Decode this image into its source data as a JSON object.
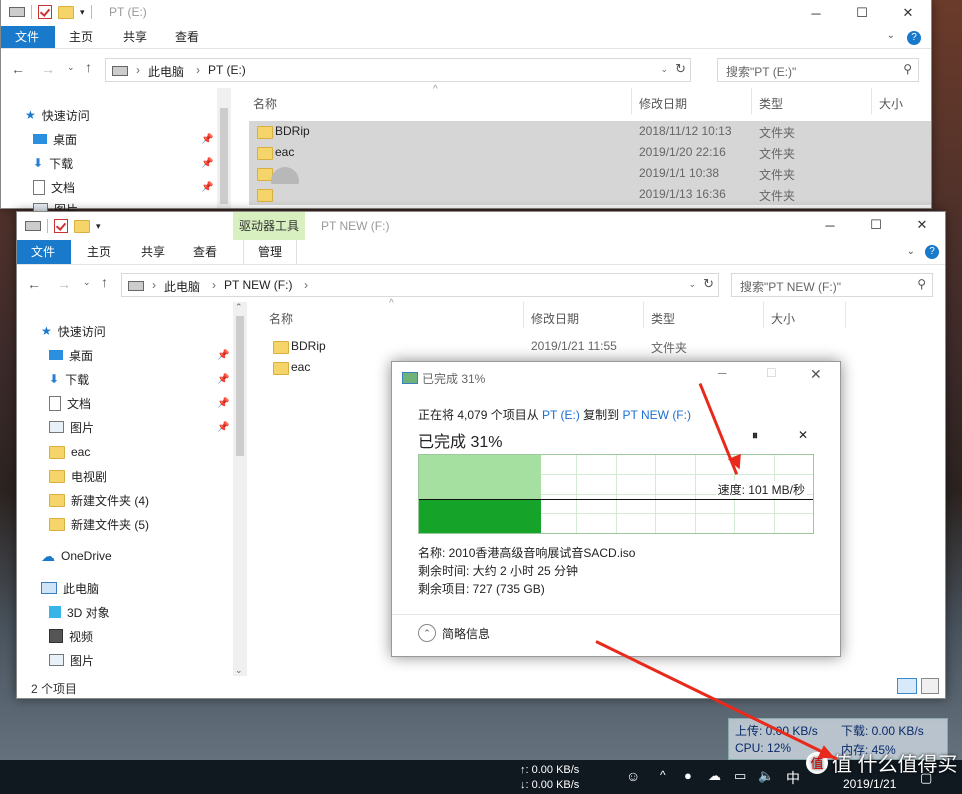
{
  "back_window": {
    "title": "PT (E:)",
    "tabs": [
      "文件",
      "主页",
      "共享",
      "查看"
    ],
    "path": [
      "此电脑",
      "PT (E:)"
    ],
    "search_placeholder": "搜索\"PT (E:)\"",
    "columns": [
      "名称",
      "修改日期",
      "类型",
      "大小"
    ],
    "quick_access": "快速访问",
    "sidebar": [
      {
        "label": "桌面",
        "icon": "desktop-icon"
      },
      {
        "label": "下载",
        "icon": "download-icon"
      },
      {
        "label": "文档",
        "icon": "document-icon"
      },
      {
        "label": "图片",
        "icon": "picture-icon"
      }
    ],
    "rows": [
      {
        "name": "BDRip",
        "date": "2018/11/12 10:13",
        "type": "文件夹"
      },
      {
        "name": "eac",
        "date": "2019/1/20 22:16",
        "type": "文件夹"
      },
      {
        "name": "",
        "date": "2019/1/1 10:38",
        "type": "文件夹"
      },
      {
        "name": "",
        "date": "2019/1/13 16:36",
        "type": "文件夹"
      }
    ]
  },
  "front_window": {
    "title": "PT NEW (F:)",
    "context_tab": "驱动器工具",
    "tabs": [
      "文件",
      "主页",
      "共享",
      "查看",
      "管理"
    ],
    "path": [
      "此电脑",
      "PT NEW (F:)"
    ],
    "search_placeholder": "搜索\"PT NEW (F:)\"",
    "columns": [
      "名称",
      "修改日期",
      "类型",
      "大小"
    ],
    "quick_access": "快速访问",
    "sidebar": [
      {
        "label": "桌面",
        "icon": "desktop-icon",
        "pinned": true
      },
      {
        "label": "下载",
        "icon": "download-icon",
        "pinned": true
      },
      {
        "label": "文档",
        "icon": "document-icon",
        "pinned": true
      },
      {
        "label": "图片",
        "icon": "picture-icon",
        "pinned": true
      },
      {
        "label": "eac",
        "icon": "folder-icon"
      },
      {
        "label": "电视剧",
        "icon": "folder-icon"
      },
      {
        "label": "新建文件夹 (4)",
        "icon": "folder-icon"
      },
      {
        "label": "新建文件夹 (5)",
        "icon": "folder-icon"
      }
    ],
    "onedrive": "OneDrive",
    "this_pc": "此电脑",
    "pc_items": [
      {
        "label": "3D 对象",
        "icon": "cube-icon"
      },
      {
        "label": "视频",
        "icon": "video-icon"
      },
      {
        "label": "图片",
        "icon": "picture-icon"
      }
    ],
    "rows": [
      {
        "name": "BDRip",
        "date": "2019/1/21 11:55",
        "type": "文件夹"
      },
      {
        "name": "eac",
        "date": "",
        "type": ""
      }
    ],
    "status": "2 个项目"
  },
  "copy_dialog": {
    "title": "已完成 31%",
    "desc_prefix": "正在将 4,079 个项目从",
    "src": "PT (E:)",
    "mid": "复制到",
    "dst": "PT NEW (F:)",
    "progress_label": "已完成 31%",
    "progress": 0.31,
    "speed": "速度: 101 MB/秒",
    "name": "名称: 2010香港高级音响展试音SACD.iso",
    "time_left": "剩余时间: 大约 2 小时 25 分钟",
    "items_left": "剩余项目: 727 (735 GB)",
    "details": "简略信息",
    "colors": {
      "fill": "#16a32a",
      "light": "#a5e0a0",
      "link": "#1a6fd0"
    }
  },
  "net_widget": {
    "up": "上传: 0.00 KB/s",
    "down": "下载: 0.00 KB/s",
    "cpu": "CPU: 12%",
    "mem": "内存: 45%"
  },
  "taskbar": {
    "net_up": "↑: 0.00 KB/s",
    "net_down": "↓: 0.00 KB/s",
    "ime": "中",
    "date": "2019/1/21"
  },
  "watermark": "值 什么值得买"
}
